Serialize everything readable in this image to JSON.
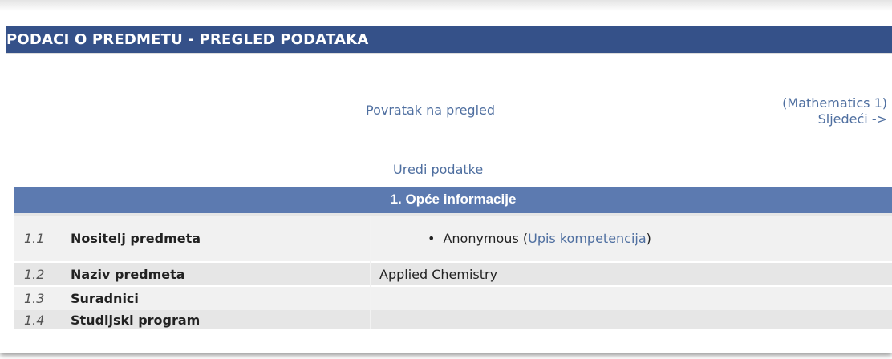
{
  "header": {
    "title": "PODACI O PREDMETU - PREGLED PODATAKA"
  },
  "nav": {
    "back_label": "Povratak na pregled",
    "next_course": "(Mathematics 1)",
    "next_label": "Sljedeći ->",
    "edit_label": "Uredi podatke"
  },
  "section": {
    "title": "1. Opće informacije",
    "rows": [
      {
        "num": "1.1",
        "label": "Nositelj predmeta",
        "value_name": "Anonymous",
        "value_link": "Upis kompetencija"
      },
      {
        "num": "1.2",
        "label": "Naziv predmeta",
        "value": "Applied Chemistry"
      },
      {
        "num": "1.3",
        "label": "Suradnici",
        "value": ""
      },
      {
        "num": "1.4",
        "label": "Studijski program",
        "value": ""
      }
    ]
  }
}
